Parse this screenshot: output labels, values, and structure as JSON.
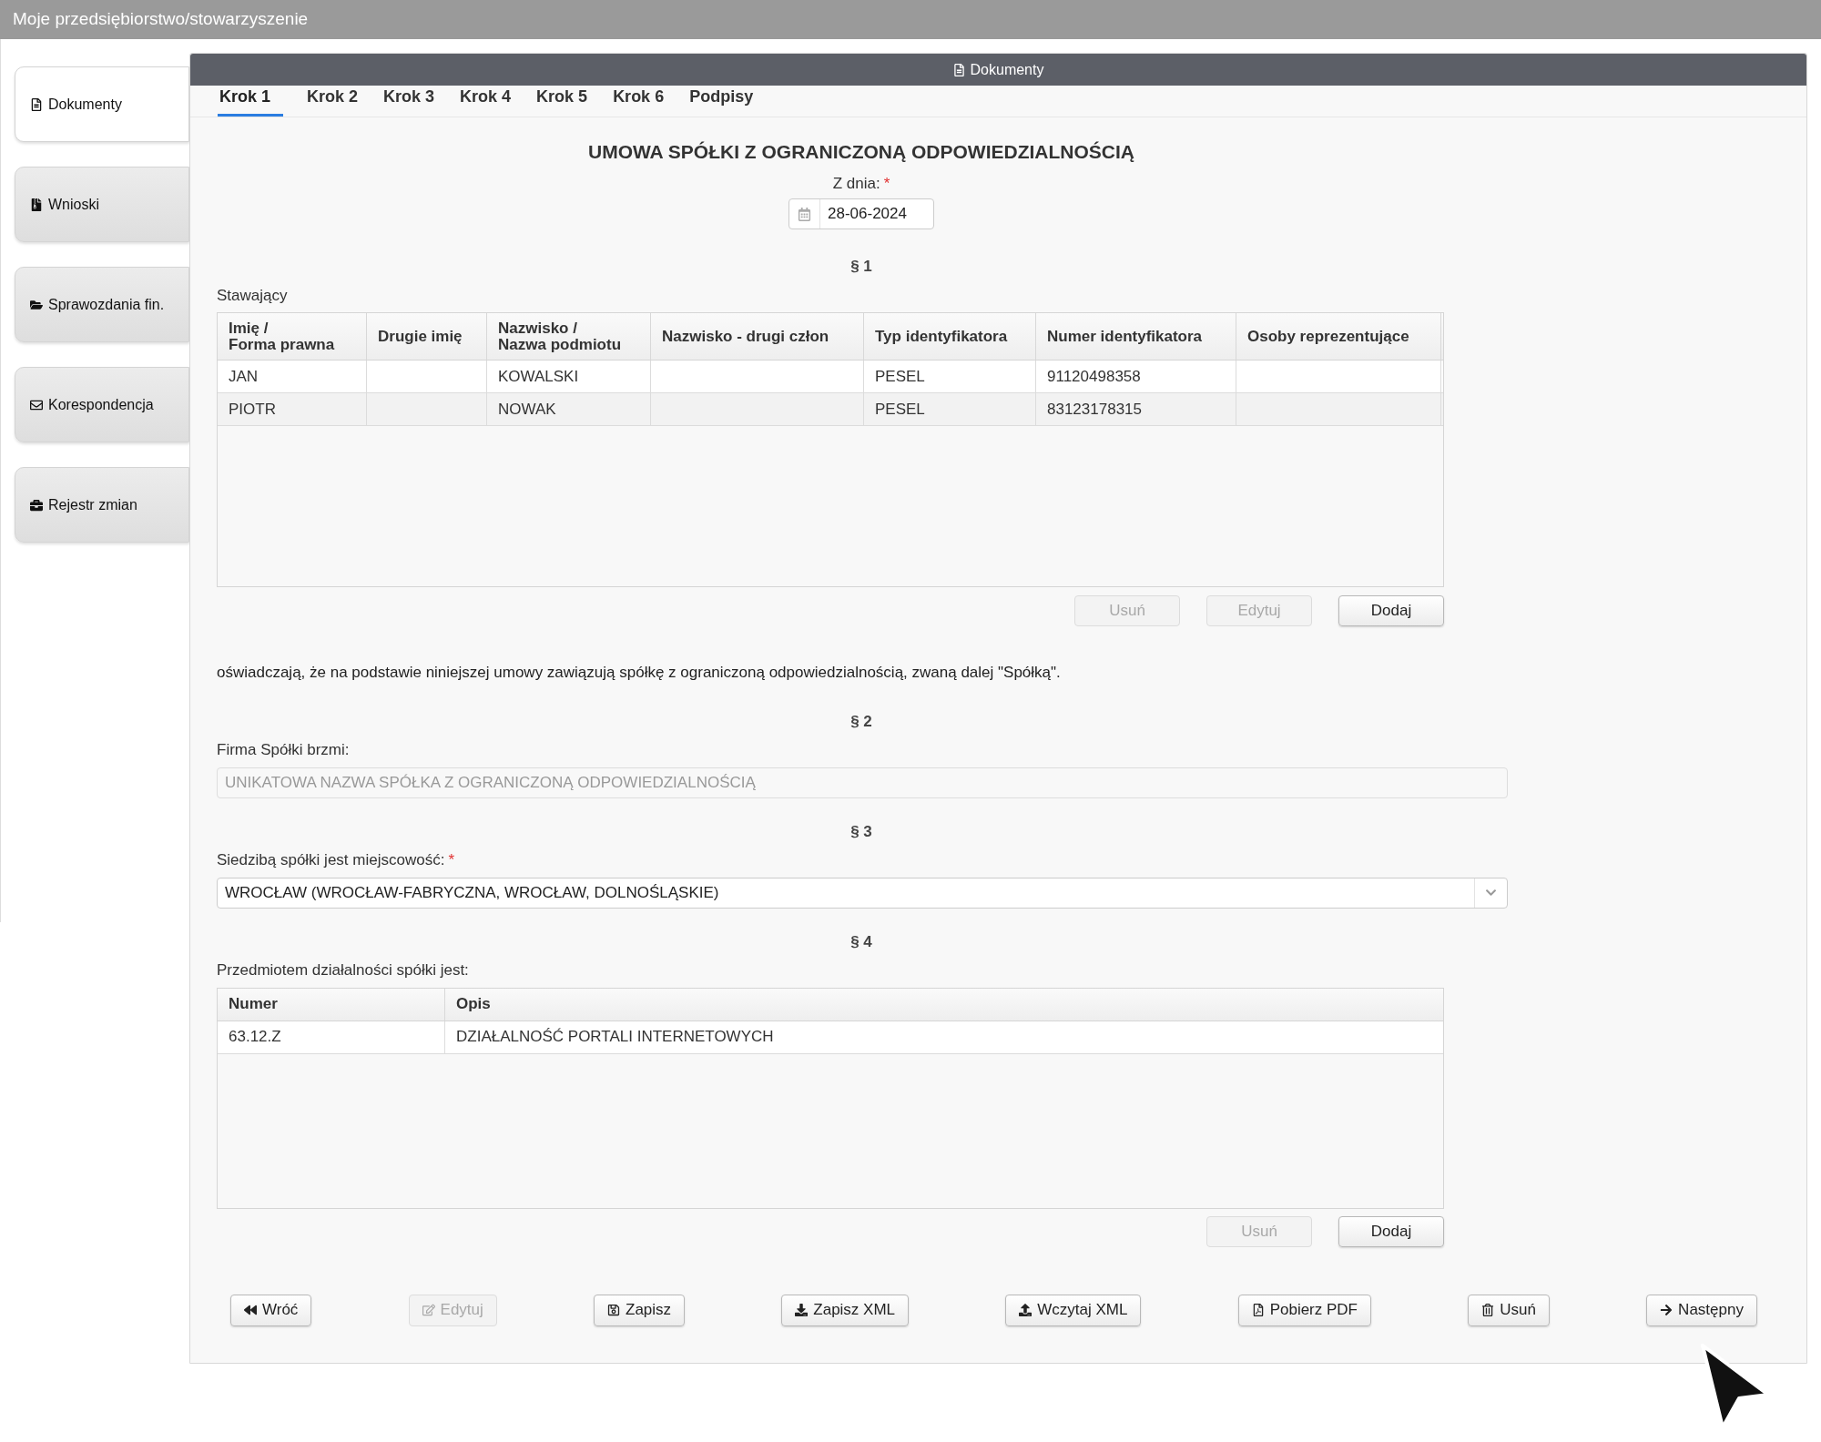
{
  "app_bar": {
    "title": "Moje przedsiębiorstwo/stowarzyszenie"
  },
  "sidebar": {
    "items": [
      {
        "label": "Dokumenty",
        "selected": true
      },
      {
        "label": "Wnioski",
        "selected": false
      },
      {
        "label": "Sprawozdania fin.",
        "selected": false
      },
      {
        "label": "Korespondencja",
        "selected": false
      },
      {
        "label": "Rejestr zmian",
        "selected": false
      }
    ]
  },
  "panel": {
    "title": "Dokumenty",
    "tabs": [
      {
        "label": "Krok 1",
        "selected": true
      },
      {
        "label": "Krok 2",
        "selected": false
      },
      {
        "label": "Krok 3",
        "selected": false
      },
      {
        "label": "Krok 4",
        "selected": false
      },
      {
        "label": "Krok 5",
        "selected": false
      },
      {
        "label": "Krok 6",
        "selected": false
      },
      {
        "label": "Podpisy",
        "selected": false
      }
    ],
    "heading": "UMOWA SPÓŁKI Z OGRANICZONĄ ODPOWIEDZIALNOŚCIĄ",
    "date": {
      "label": "Z dnia:",
      "required_mark": "*",
      "value": "28-06-2024"
    },
    "section1": {
      "title": "§ 1",
      "label": "Stawający",
      "columns": [
        "Imię /\nForma prawna",
        "Drugie imię",
        "Nazwisko /\nNazwa podmiotu",
        "Nazwisko - drugi człon",
        "Typ identyfikatora",
        "Numer identyfikatora",
        "Osoby reprezentujące"
      ],
      "rows": [
        [
          "JAN",
          "",
          "KOWALSKI",
          "",
          "PESEL",
          "91120498358",
          ""
        ],
        [
          "PIOTR",
          "",
          "NOWAK",
          "",
          "PESEL",
          "83123178315",
          ""
        ]
      ],
      "buttons": [
        {
          "label": "Usuń",
          "disabled": true
        },
        {
          "label": "Edytuj",
          "disabled": true
        },
        {
          "label": "Dodaj",
          "disabled": false
        }
      ],
      "statement": "oświadczają, że na podstawie niniejszej umowy zawiązują spółkę z ograniczoną odpowiedzialnością, zwaną dalej \"Spółką\"."
    },
    "section2": {
      "title": "§ 2",
      "label": "Firma Spółki brzmi:",
      "value": "UNIKATOWA NAZWA SPÓŁKA Z OGRANICZONĄ ODPOWIEDZIALNOŚCIĄ",
      "disabled": true
    },
    "section3": {
      "title": "§ 3",
      "label": "Siedzibą spółki jest miejscowość:",
      "required_mark": "*",
      "value": "WROCŁAW (WROCŁAW-FABRYCZNA, WROCŁAW, DOLNOŚLĄSKIE)"
    },
    "section4": {
      "title": "§ 4",
      "label": "Przedmiotem działalności spółki jest:",
      "columns": [
        "Numer",
        "Opis"
      ],
      "rows": [
        [
          "63.12.Z",
          "DZIAŁALNOŚĆ PORTALI INTERNETOWYCH"
        ]
      ],
      "buttons": [
        {
          "label": "Usuń",
          "disabled": true
        },
        {
          "label": "Dodaj",
          "disabled": false
        }
      ]
    },
    "footer_buttons": [
      {
        "kind": "back",
        "label": "Wróć",
        "disabled": false
      },
      {
        "kind": "edit",
        "label": "Edytuj",
        "disabled": true
      },
      {
        "kind": "save",
        "label": "Zapisz",
        "disabled": false
      },
      {
        "kind": "download",
        "label": "Zapisz XML",
        "disabled": false
      },
      {
        "kind": "upload",
        "label": "Wczytaj XML",
        "disabled": false
      },
      {
        "kind": "pdf",
        "label": "Pobierz PDF",
        "disabled": false
      },
      {
        "kind": "delete",
        "label": "Usuń",
        "disabled": false
      },
      {
        "kind": "next",
        "label": "Następny",
        "disabled": false
      }
    ]
  }
}
